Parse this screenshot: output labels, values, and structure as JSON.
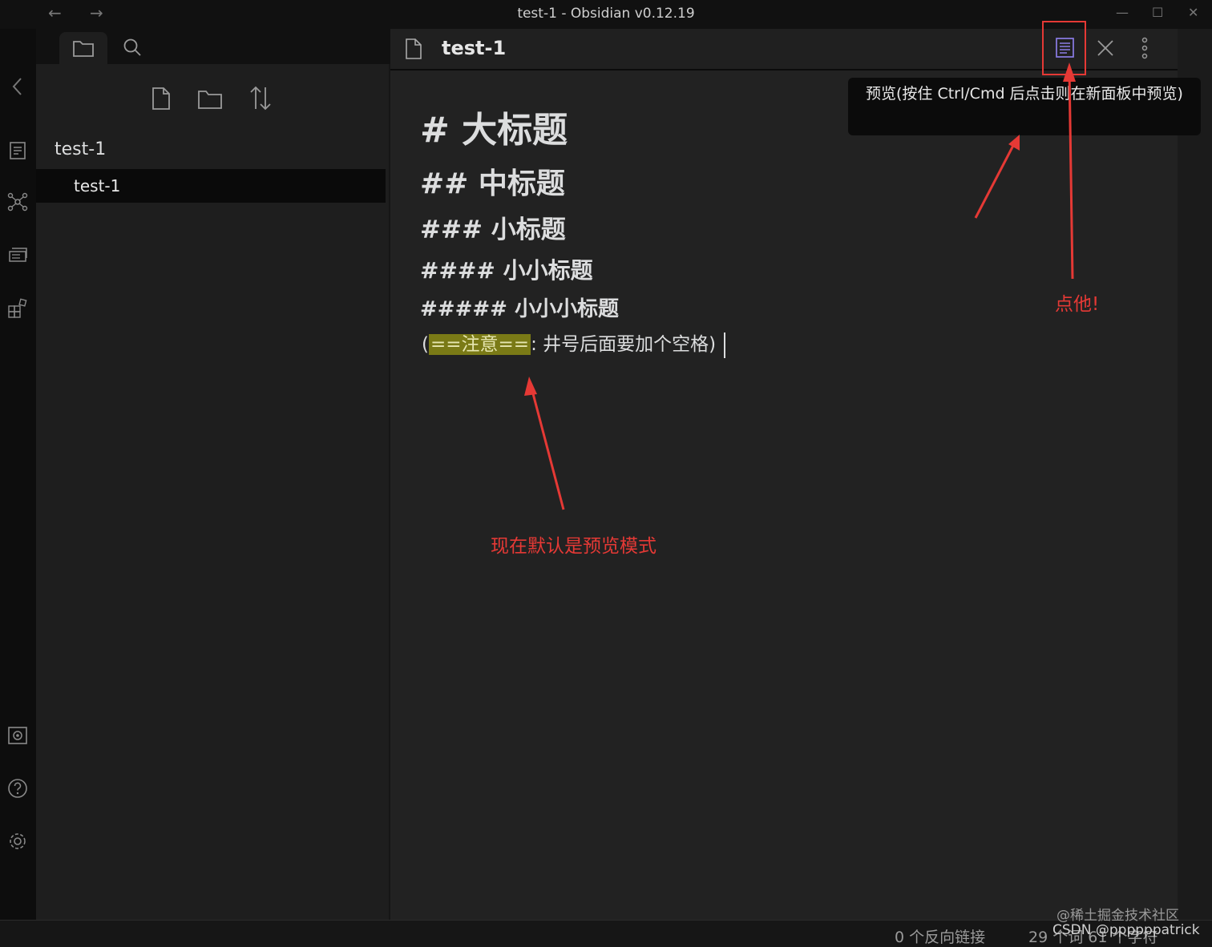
{
  "window": {
    "title": "test-1 - Obsidian v0.12.19",
    "back_label": "←",
    "forward_label": "→",
    "minimize_label": "—",
    "maximize_label": "☐",
    "close_label": "✕"
  },
  "sidebar": {
    "folder_title": "test-1",
    "files": [
      {
        "label": "test-1"
      }
    ]
  },
  "editor": {
    "tab_title": "test-1",
    "lines": {
      "h1": "# 大标题",
      "h2": "## 中标题",
      "h3": "### 小标题",
      "h4": "#### 小小标题",
      "h5": "##### 小小小标题",
      "note_open": "(",
      "note_highlight": "==注意==",
      "note_rest": ": 井号后面要加个空格)"
    }
  },
  "tooltip": {
    "text": "预览(按住 Ctrl/Cmd 后点击则在新面板中预览)"
  },
  "annotations": {
    "click_it": "点他!",
    "default_preview": "现在默认是预览模式"
  },
  "status": {
    "backlinks": "0 个反向链接",
    "counts": "29 个词 61 个字符"
  },
  "watermarks": {
    "juejin": "@稀土掘金技术社区",
    "csdn": "CSDN @ppppppatrick"
  },
  "colors": {
    "annotation": "#e53935",
    "highlight": "#7a7a16",
    "background": "#222222",
    "accent_icon": "#8b7ce6"
  },
  "icons": {
    "ribbon": [
      "open-quick-switcher-icon",
      "graph-view-icon",
      "slides-icon",
      "plugins-icon",
      "vault-icon",
      "help-icon",
      "settings-icon"
    ],
    "sidebar_tabs": [
      "folder-icon",
      "search-icon"
    ],
    "file_actions": [
      "new-note-icon",
      "new-folder-icon",
      "sort-icon"
    ],
    "editor_actions": [
      "preview-icon",
      "close-icon",
      "more-options-icon"
    ]
  }
}
